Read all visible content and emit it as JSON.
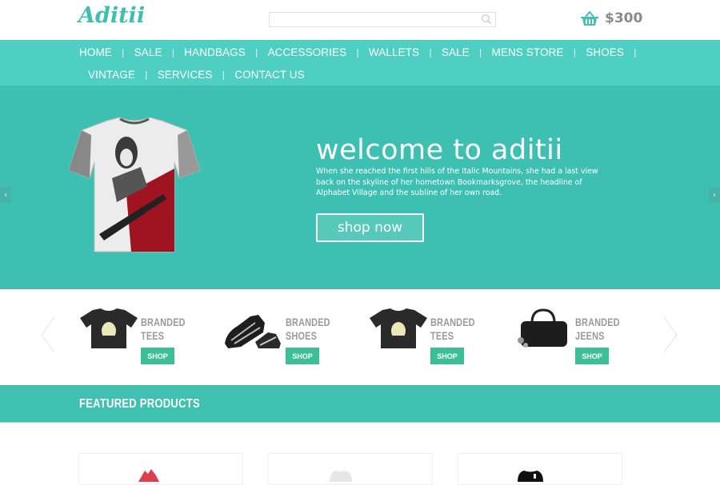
{
  "header": {
    "logo": "Aditii",
    "search": {
      "value": "",
      "placeholder": "",
      "icon": "search-icon"
    },
    "cart": {
      "icon": "basket-icon",
      "total": "$300"
    }
  },
  "nav": {
    "row1": [
      "HOME",
      "SALE",
      "HANDBAGS",
      "ACCESSORIES",
      "WALLETS",
      "SALE",
      "MENS STORE",
      "SHOES"
    ],
    "row2": [
      "VINTAGE",
      "SERVICES",
      "CONTACT US"
    ],
    "separator": "|"
  },
  "hero": {
    "title": "welcome to aditii",
    "text": "When she reached the first hills of the Italic Mountains, she had a last view back on the skyline of her hometown Bookmarksgrove, the headline of Alphabet Village and the subline of her own road.",
    "cta": "shop now",
    "prev_arrow": "‹",
    "next_arrow": "›",
    "image": "graphic-tshirt-image",
    "colors": {
      "background": "#3dc0b1",
      "nav": "#4ecfc1"
    }
  },
  "categories": [
    {
      "line1": "BRANDED",
      "line2": "TEES",
      "button": "SHOP",
      "image": "black-tshirt-image"
    },
    {
      "line1": "BRANDED",
      "line2": "SHOES",
      "button": "SHOP",
      "image": "sneakers-image"
    },
    {
      "line1": "BRANDED",
      "line2": "TEES",
      "button": "SHOP",
      "image": "black-tshirt-image"
    },
    {
      "line1": "BRANDED",
      "line2": "JEENS",
      "button": "SHOP",
      "image": "handbag-image"
    }
  ],
  "featured": {
    "title": "FEATURED PRODUCTS",
    "products": [
      {
        "image": "red-product-image"
      },
      {
        "image": "white-tshirt-image"
      },
      {
        "image": "black-tshirt-image"
      }
    ]
  },
  "colors": {
    "accent": "#3fc0b1",
    "shop_button": "#3dbf96",
    "text_gray": "#9a9a9a"
  }
}
